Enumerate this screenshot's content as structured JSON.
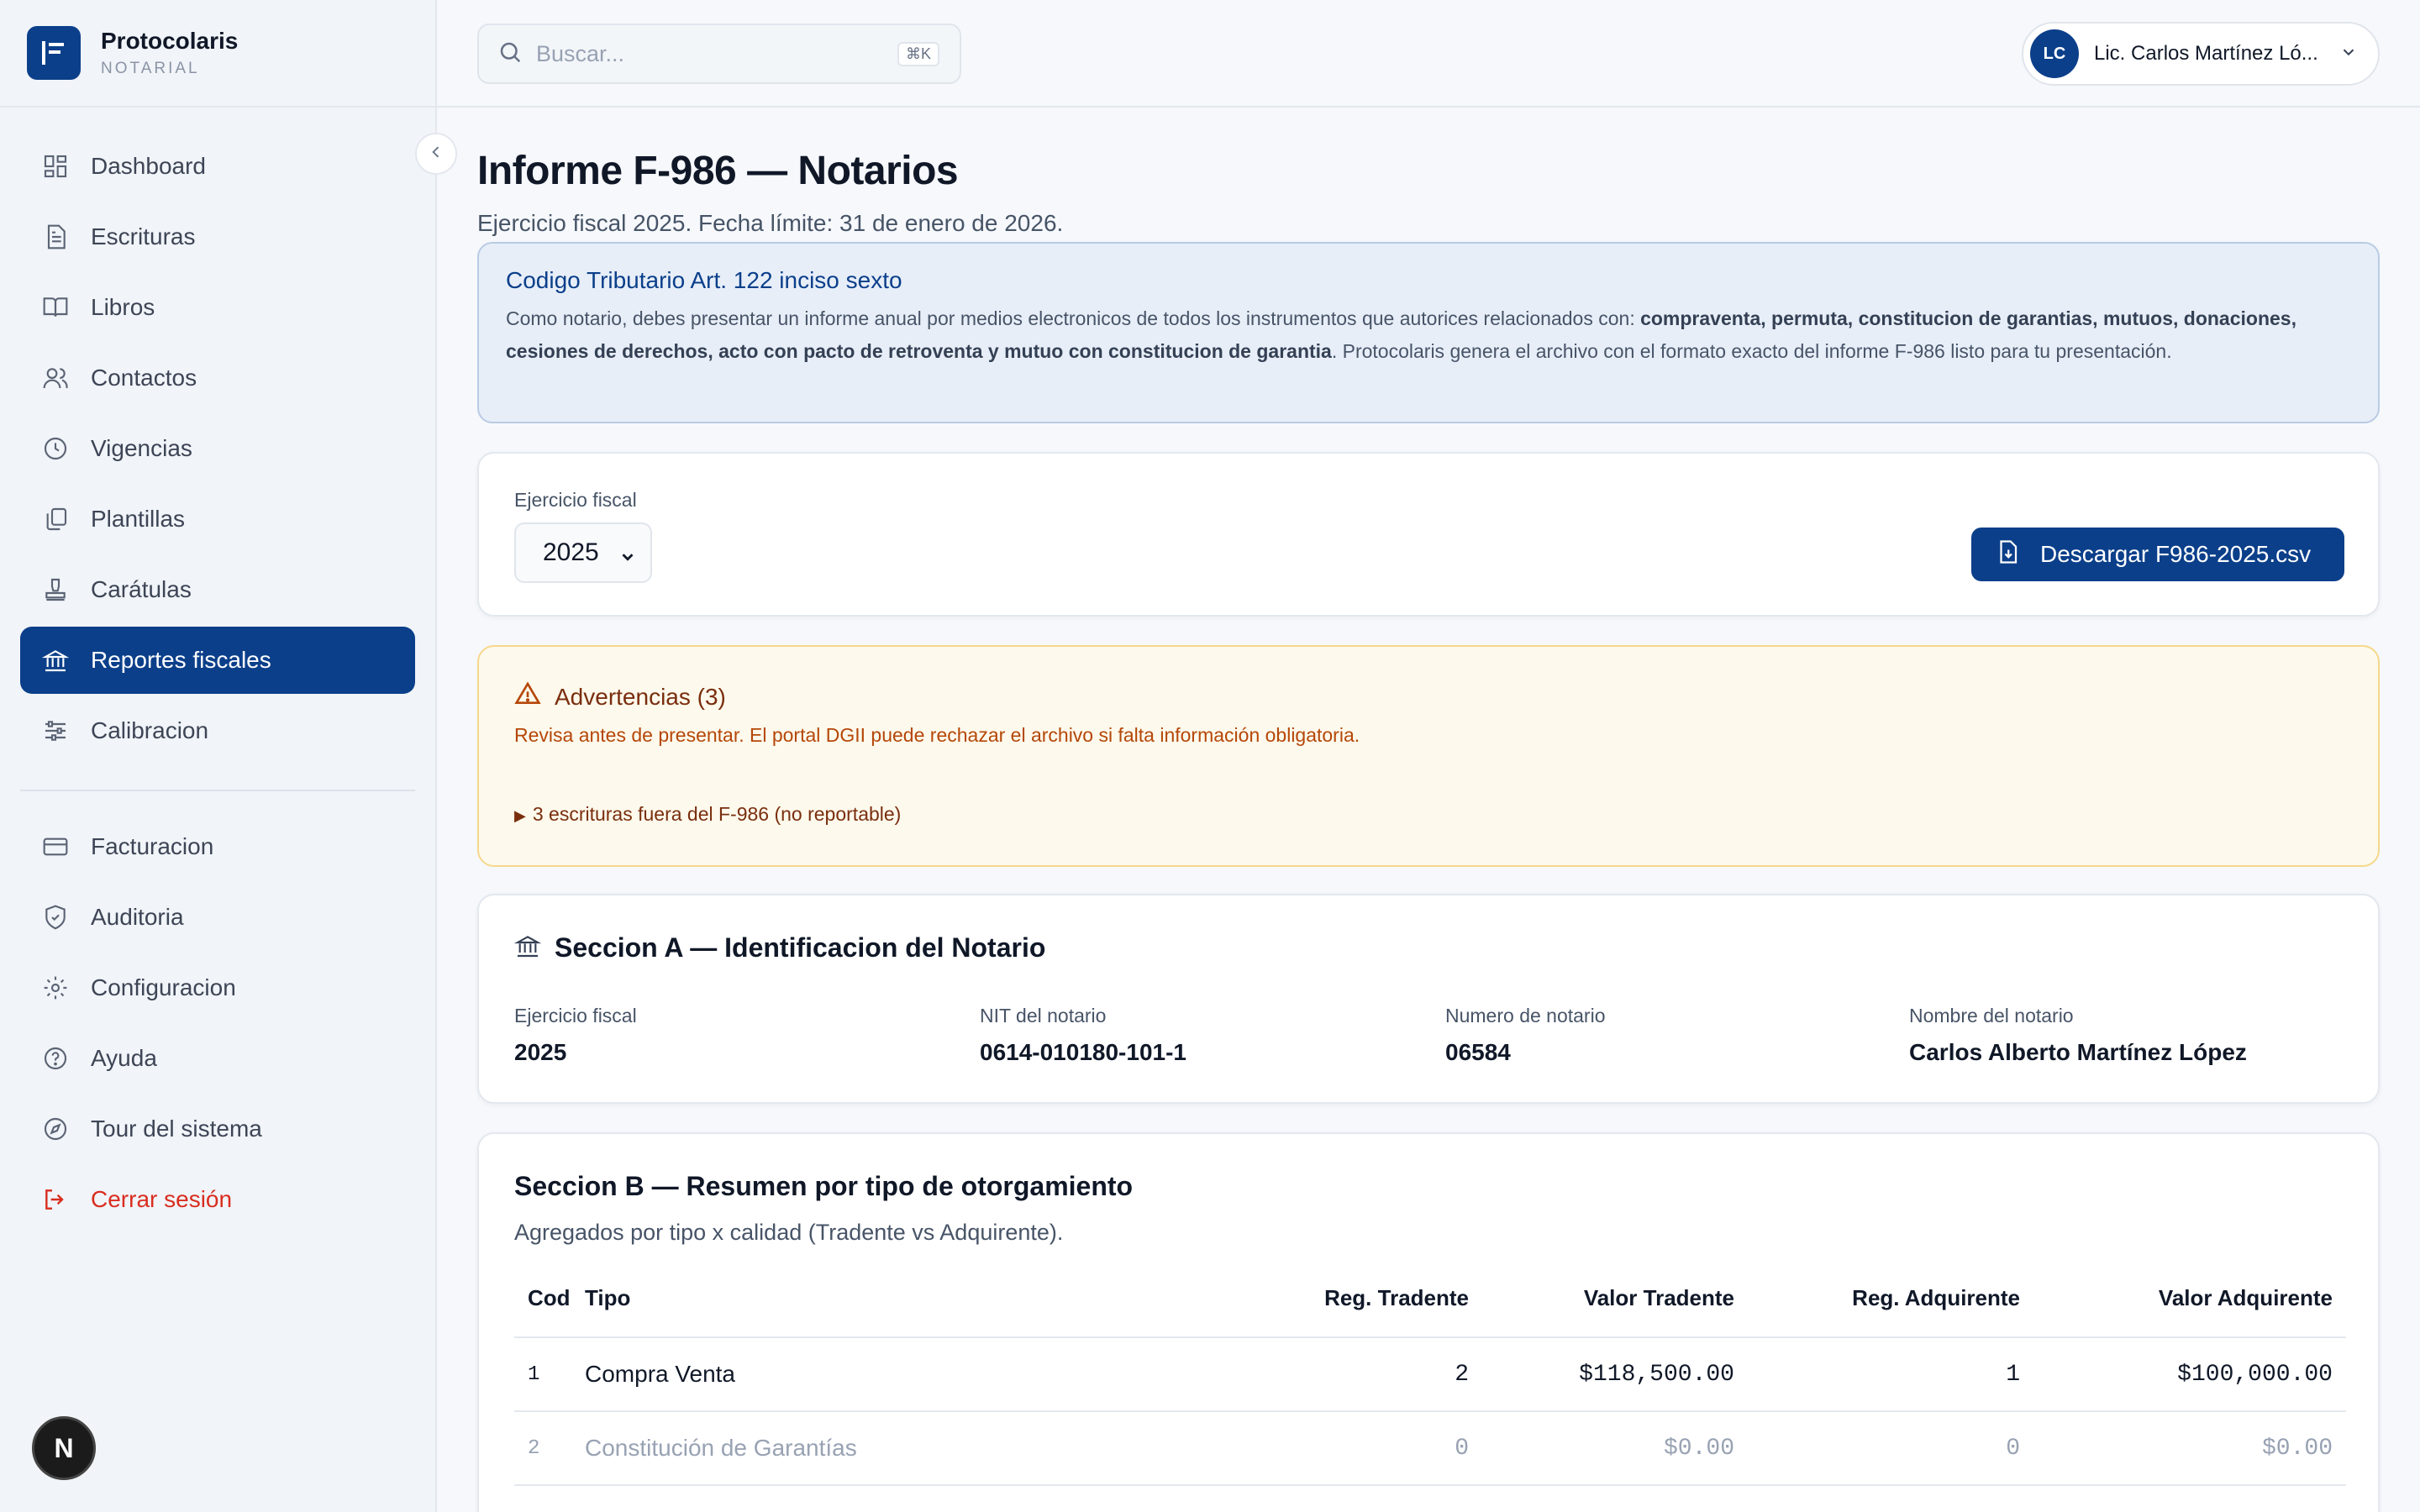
{
  "brand": {
    "name": "Protocolaris",
    "subtitle": "NOTARIAL"
  },
  "sidebar": {
    "items": [
      {
        "label": "Dashboard",
        "icon": "dashboard-icon"
      },
      {
        "label": "Escrituras",
        "icon": "document-icon"
      },
      {
        "label": "Libros",
        "icon": "book-icon"
      },
      {
        "label": "Contactos",
        "icon": "users-icon"
      },
      {
        "label": "Vigencias",
        "icon": "clock-icon"
      },
      {
        "label": "Plantillas",
        "icon": "copy-icon"
      },
      {
        "label": "Carátulas",
        "icon": "stamp-icon"
      },
      {
        "label": "Reportes fiscales",
        "icon": "bank-icon",
        "active": true
      },
      {
        "label": "Calibracion",
        "icon": "sliders-icon"
      }
    ],
    "secondary": [
      {
        "label": "Facturacion",
        "icon": "credit-card-icon"
      },
      {
        "label": "Auditoria",
        "icon": "shield-icon"
      },
      {
        "label": "Configuracion",
        "icon": "gear-icon"
      },
      {
        "label": "Ayuda",
        "icon": "help-icon"
      },
      {
        "label": "Tour del sistema",
        "icon": "compass-icon"
      },
      {
        "label": "Cerrar sesión",
        "icon": "logout-icon"
      }
    ],
    "badge": "N"
  },
  "topbar": {
    "search_placeholder": "Buscar...",
    "search_shortcut": "⌘K",
    "user_initials": "LC",
    "user_name": "Lic. Carlos Martínez Ló..."
  },
  "page": {
    "title": "Informe F-986 — Notarios",
    "subtitle": "Ejercicio fiscal 2025. Fecha límite: 31 de enero de 2026."
  },
  "info": {
    "title": "Codigo Tributario Art. 122 inciso sexto",
    "text_before": "Como notario, debes presentar un informe anual por medios electronicos de todos los instrumentos que autorices relacionados con: ",
    "text_bold": "compraventa, permuta, constitucion de garantias, mutuos, donaciones, cesiones de derechos, acto con pacto de retroventa y mutuo con constitucion de garantia",
    "text_after": ". Protocolaris genera el archivo con el formato exacto del informe F-986 listo para tu presentación."
  },
  "filter": {
    "label": "Ejercicio fiscal",
    "selected_year": "2025",
    "download_label": "Descargar F986-2025.csv"
  },
  "warnings": {
    "title": "Advertencias (3)",
    "message": "Revisa antes de presentar. El portal DGII puede rechazar el archivo si falta información obligatoria.",
    "details": "3 escrituras fuera del F-986 (no reportable)"
  },
  "section_a": {
    "title": "Seccion A — Identificacion del Notario",
    "fields": [
      {
        "label": "Ejercicio fiscal",
        "value": "2025"
      },
      {
        "label": "NIT del notario",
        "value": "0614-010180-101-1"
      },
      {
        "label": "Numero de notario",
        "value": "06584"
      },
      {
        "label": "Nombre del notario",
        "value": "Carlos Alberto Martínez López"
      }
    ]
  },
  "section_b": {
    "title": "Seccion B — Resumen por tipo de otorgamiento",
    "subtitle": "Agregados por tipo x calidad (Tradente vs Adquirente).",
    "columns": [
      "Cod",
      "Tipo",
      "Reg. Tradente",
      "Valor Tradente",
      "Reg. Adquirente",
      "Valor Adquirente"
    ],
    "rows": [
      {
        "cod": "1",
        "tipo": "Compra Venta",
        "reg_tradente": "2",
        "valor_tradente": "$118,500.00",
        "reg_adquirente": "1",
        "valor_adquirente": "$100,000.00"
      },
      {
        "cod": "2",
        "tipo": "Constitución de Garantías",
        "reg_tradente": "0",
        "valor_tradente": "$0.00",
        "reg_adquirente": "0",
        "valor_adquirente": "$0.00"
      }
    ]
  },
  "colors": {
    "primary": "#0b3f8a",
    "danger": "#d92d20",
    "warning_bg": "#fdf9ec",
    "info_bg": "#e7eef8"
  }
}
